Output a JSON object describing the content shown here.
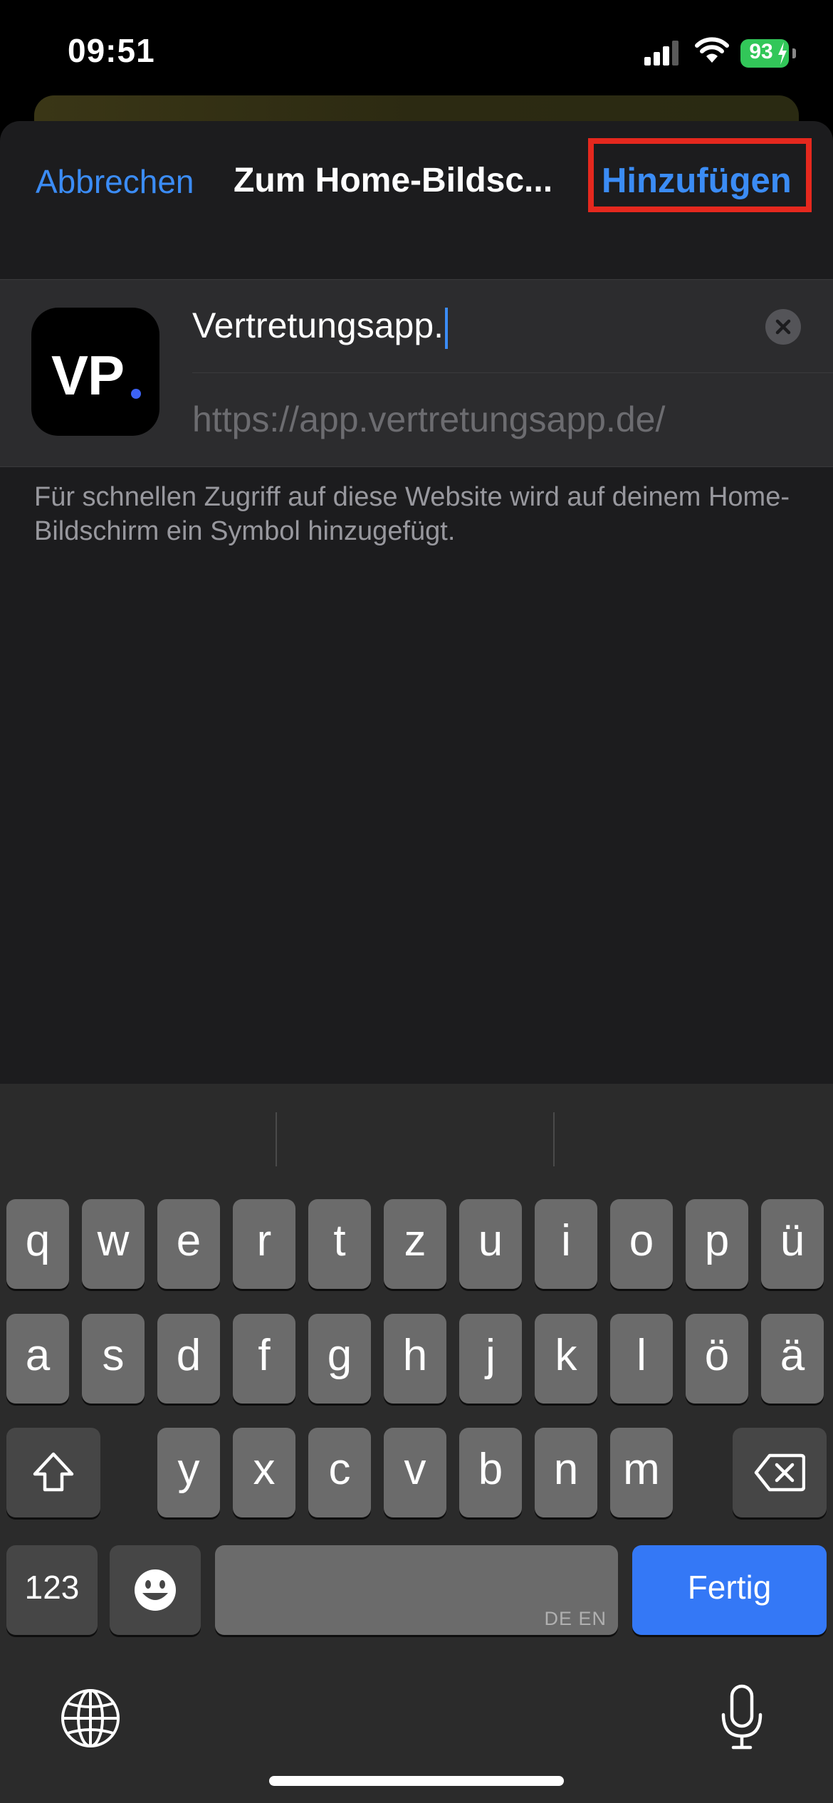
{
  "status_bar": {
    "time": "09:51",
    "battery_percent": "93",
    "battery_color": "#32c759",
    "icons": [
      "signal-icon",
      "wifi-icon",
      "battery-icon"
    ]
  },
  "nav": {
    "cancel_label": "Abbrechen",
    "title": "Zum Home-Bildsc...",
    "add_label": "Hinzufügen",
    "accent_color": "#3b8cf5",
    "highlight_color": "#e5281e"
  },
  "form": {
    "app_icon_text": "VP",
    "name_value": "Vertretungsapp.",
    "url": "https://app.vertretungsapp.de/",
    "clear_icon": "close-icon"
  },
  "info_text": "Für schnellen Zugriff auf diese Website wird auf deinem Home-Bildschirm ein Symbol hinzugefügt.",
  "keyboard": {
    "row1": [
      "q",
      "w",
      "e",
      "r",
      "t",
      "z",
      "u",
      "i",
      "o",
      "p",
      "ü"
    ],
    "row2": [
      "a",
      "s",
      "d",
      "f",
      "g",
      "h",
      "j",
      "k",
      "l",
      "ö",
      "ä"
    ],
    "row3": [
      "y",
      "x",
      "c",
      "v",
      "b",
      "n",
      "m"
    ],
    "numbers_label": "123",
    "space_lang": "DE EN",
    "done_label": "Fertig",
    "done_color": "#3478f6",
    "icons": [
      "shift-icon",
      "delete-icon",
      "emoji-icon",
      "globe-icon",
      "microphone-icon"
    ]
  }
}
